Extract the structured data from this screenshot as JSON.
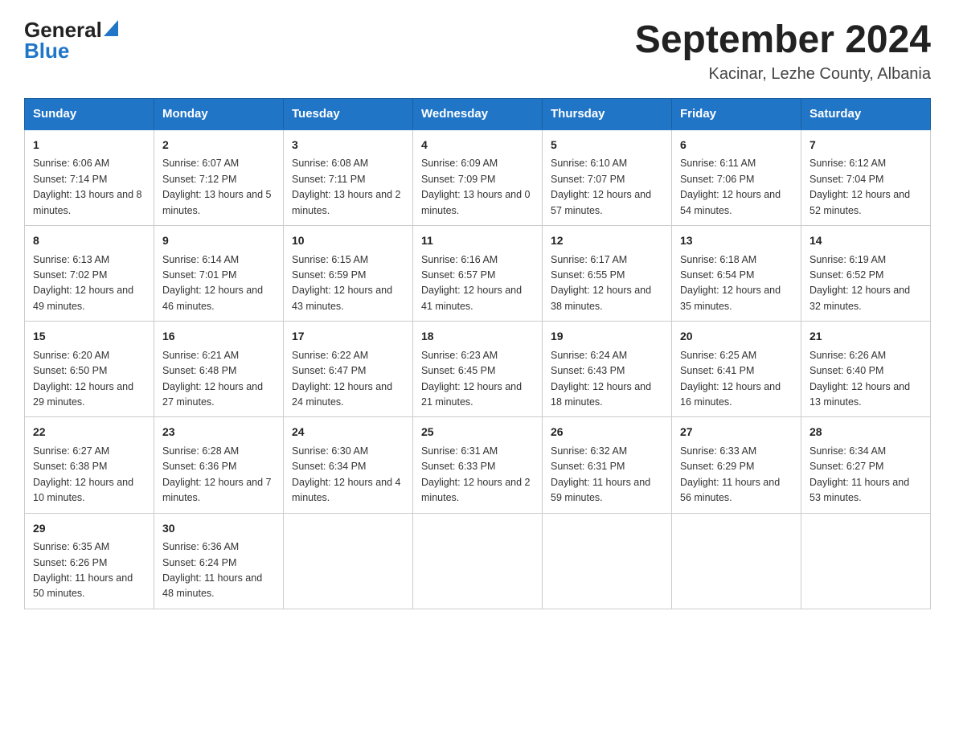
{
  "logo": {
    "general": "General",
    "triangle": "▶",
    "blue": "Blue"
  },
  "title": "September 2024",
  "location": "Kacinar, Lezhe County, Albania",
  "days_of_week": [
    "Sunday",
    "Monday",
    "Tuesday",
    "Wednesday",
    "Thursday",
    "Friday",
    "Saturday"
  ],
  "weeks": [
    [
      {
        "day": "1",
        "sunrise": "6:06 AM",
        "sunset": "7:14 PM",
        "daylight": "13 hours and 8 minutes."
      },
      {
        "day": "2",
        "sunrise": "6:07 AM",
        "sunset": "7:12 PM",
        "daylight": "13 hours and 5 minutes."
      },
      {
        "day": "3",
        "sunrise": "6:08 AM",
        "sunset": "7:11 PM",
        "daylight": "13 hours and 2 minutes."
      },
      {
        "day": "4",
        "sunrise": "6:09 AM",
        "sunset": "7:09 PM",
        "daylight": "13 hours and 0 minutes."
      },
      {
        "day": "5",
        "sunrise": "6:10 AM",
        "sunset": "7:07 PM",
        "daylight": "12 hours and 57 minutes."
      },
      {
        "day": "6",
        "sunrise": "6:11 AM",
        "sunset": "7:06 PM",
        "daylight": "12 hours and 54 minutes."
      },
      {
        "day": "7",
        "sunrise": "6:12 AM",
        "sunset": "7:04 PM",
        "daylight": "12 hours and 52 minutes."
      }
    ],
    [
      {
        "day": "8",
        "sunrise": "6:13 AM",
        "sunset": "7:02 PM",
        "daylight": "12 hours and 49 minutes."
      },
      {
        "day": "9",
        "sunrise": "6:14 AM",
        "sunset": "7:01 PM",
        "daylight": "12 hours and 46 minutes."
      },
      {
        "day": "10",
        "sunrise": "6:15 AM",
        "sunset": "6:59 PM",
        "daylight": "12 hours and 43 minutes."
      },
      {
        "day": "11",
        "sunrise": "6:16 AM",
        "sunset": "6:57 PM",
        "daylight": "12 hours and 41 minutes."
      },
      {
        "day": "12",
        "sunrise": "6:17 AM",
        "sunset": "6:55 PM",
        "daylight": "12 hours and 38 minutes."
      },
      {
        "day": "13",
        "sunrise": "6:18 AM",
        "sunset": "6:54 PM",
        "daylight": "12 hours and 35 minutes."
      },
      {
        "day": "14",
        "sunrise": "6:19 AM",
        "sunset": "6:52 PM",
        "daylight": "12 hours and 32 minutes."
      }
    ],
    [
      {
        "day": "15",
        "sunrise": "6:20 AM",
        "sunset": "6:50 PM",
        "daylight": "12 hours and 29 minutes."
      },
      {
        "day": "16",
        "sunrise": "6:21 AM",
        "sunset": "6:48 PM",
        "daylight": "12 hours and 27 minutes."
      },
      {
        "day": "17",
        "sunrise": "6:22 AM",
        "sunset": "6:47 PM",
        "daylight": "12 hours and 24 minutes."
      },
      {
        "day": "18",
        "sunrise": "6:23 AM",
        "sunset": "6:45 PM",
        "daylight": "12 hours and 21 minutes."
      },
      {
        "day": "19",
        "sunrise": "6:24 AM",
        "sunset": "6:43 PM",
        "daylight": "12 hours and 18 minutes."
      },
      {
        "day": "20",
        "sunrise": "6:25 AM",
        "sunset": "6:41 PM",
        "daylight": "12 hours and 16 minutes."
      },
      {
        "day": "21",
        "sunrise": "6:26 AM",
        "sunset": "6:40 PM",
        "daylight": "12 hours and 13 minutes."
      }
    ],
    [
      {
        "day": "22",
        "sunrise": "6:27 AM",
        "sunset": "6:38 PM",
        "daylight": "12 hours and 10 minutes."
      },
      {
        "day": "23",
        "sunrise": "6:28 AM",
        "sunset": "6:36 PM",
        "daylight": "12 hours and 7 minutes."
      },
      {
        "day": "24",
        "sunrise": "6:30 AM",
        "sunset": "6:34 PM",
        "daylight": "12 hours and 4 minutes."
      },
      {
        "day": "25",
        "sunrise": "6:31 AM",
        "sunset": "6:33 PM",
        "daylight": "12 hours and 2 minutes."
      },
      {
        "day": "26",
        "sunrise": "6:32 AM",
        "sunset": "6:31 PM",
        "daylight": "11 hours and 59 minutes."
      },
      {
        "day": "27",
        "sunrise": "6:33 AM",
        "sunset": "6:29 PM",
        "daylight": "11 hours and 56 minutes."
      },
      {
        "day": "28",
        "sunrise": "6:34 AM",
        "sunset": "6:27 PM",
        "daylight": "11 hours and 53 minutes."
      }
    ],
    [
      {
        "day": "29",
        "sunrise": "6:35 AM",
        "sunset": "6:26 PM",
        "daylight": "11 hours and 50 minutes."
      },
      {
        "day": "30",
        "sunrise": "6:36 AM",
        "sunset": "6:24 PM",
        "daylight": "11 hours and 48 minutes."
      },
      null,
      null,
      null,
      null,
      null
    ]
  ]
}
